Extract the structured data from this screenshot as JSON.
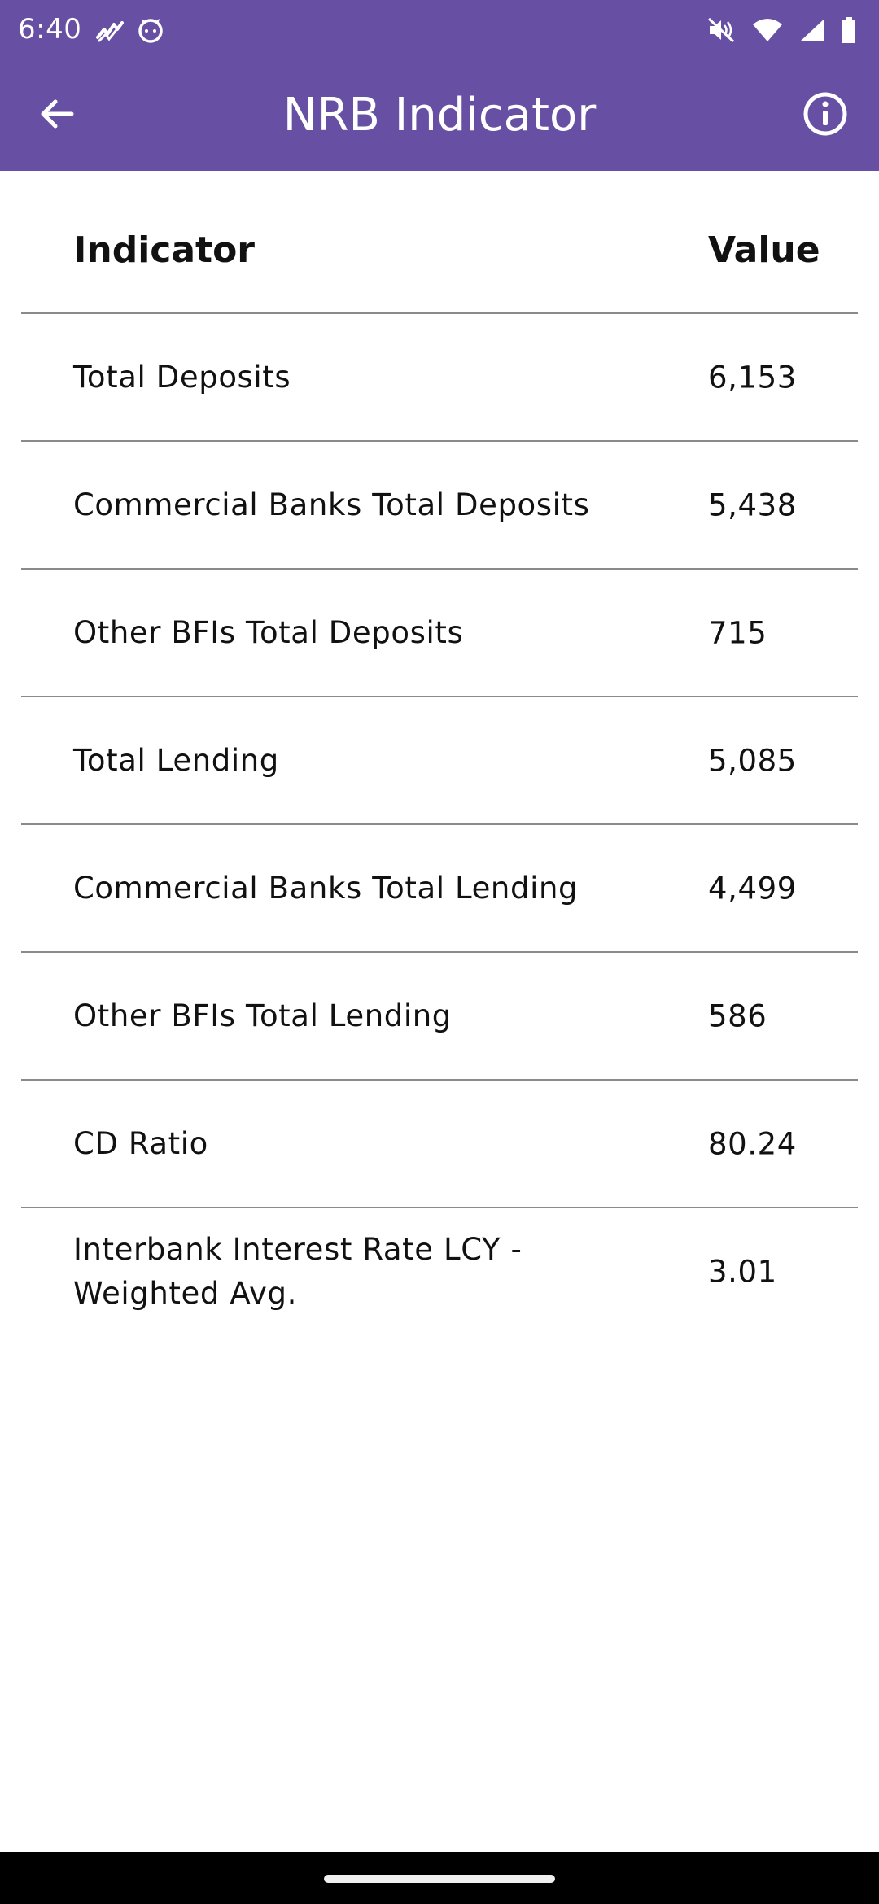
{
  "status_bar": {
    "time": "6:40",
    "left_icons": [
      "activity-icon",
      "cat-face-icon"
    ],
    "right_icons": [
      "mute-icon",
      "wifi-icon",
      "signal-icon",
      "battery-icon"
    ]
  },
  "app_bar": {
    "title": "NRB Indicator",
    "back_icon": "arrow-left-icon",
    "info_icon": "info-icon",
    "background_color": "#6750a4"
  },
  "table": {
    "columns": [
      "Indicator",
      "Value"
    ],
    "rows": [
      {
        "indicator": "Total Deposits",
        "value": "6,153"
      },
      {
        "indicator": "Commercial Banks Total Deposits",
        "value": "5,438"
      },
      {
        "indicator": "Other BFIs Total Deposits",
        "value": "715"
      },
      {
        "indicator": "Total Lending",
        "value": "5,085"
      },
      {
        "indicator": "Commercial Banks Total Lending",
        "value": "4,499"
      },
      {
        "indicator": "Other BFIs Total Lending",
        "value": "586"
      },
      {
        "indicator": "CD Ratio",
        "value": "80.24"
      },
      {
        "indicator": "Interbank Interest Rate LCY - Weighted Avg.",
        "value": "3.01"
      }
    ]
  }
}
